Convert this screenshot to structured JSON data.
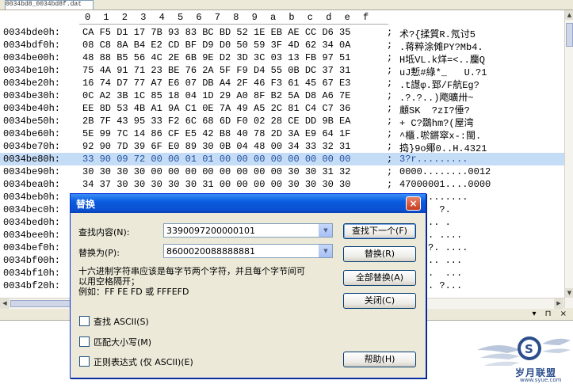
{
  "editor": {
    "tab_label": "0034bd8_0034bd8f.dat",
    "ruler": [
      "0",
      "1",
      "2",
      "3",
      "4",
      "5",
      "6",
      "7",
      "8",
      "9",
      "a",
      "b",
      "c",
      "d",
      "e",
      "f"
    ],
    "rows": [
      {
        "addr": "0034bde0h:",
        "hex": "CA F5 D1 17 7B 93 83 BC BD 52 1E EB AE CC D6 35",
        "ascii": "术?{揉質R.氖讨5"
      },
      {
        "addr": "0034bdf0h:",
        "hex": "08 C8 8A B4 E2 CD BF D9 D0 50 59 3F 4D 62 34 0A",
        "ascii": ".蒋粹涂傩PY?Mb4."
      },
      {
        "addr": "0034be00h:",
        "hex": "48 88 B5 56 4C 2E 6B 9E D2 3D 3C 03 13 FB 97 51",
        "ascii": "H坻VL.k烊=<..麕Q"
      },
      {
        "addr": "0034be10h:",
        "hex": "75 4A 91 71 23 BE 76 2A 5F F9 D4 55 0B DC 37 31",
        "ascii": "uJ慙#綠*_   U.?1"
      },
      {
        "addr": "0034be20h:",
        "hex": "16 74 D7 77 A7 E6 07 DB A4 2F 46 F3 61 45 67 E3",
        "ascii": ".t譿φ.郅/F航Eg?"
      },
      {
        "addr": "0034be30h:",
        "hex": "0C A2 3B 1C 85 18 04 1D 29 A0 8F B2 5A D8 A6 7E",
        "ascii": ".?.?..)飑曠卅~"
      },
      {
        "addr": "0034be40h:",
        "hex": "EE 8D 53 4B A1 9A C1 0E 7A 49 A5 2C 81 C4 C7 36",
        "ascii": "顪SK  ?zI?倕?"
      },
      {
        "addr": "0034be50h:",
        "hex": "2B 7F 43 95 33 F2 6C 68 6D F0 02 28 CE DD 9B EA",
        "ascii": "+ C?鵽hm?(屋湾"
      },
      {
        "addr": "0034be60h:",
        "hex": "5E 99 7C 14 86 CF E5 42 B8 40 78 2D 3A E9 64 1F",
        "ascii": "^櫃.唹鏘窣x-:閩."
      },
      {
        "addr": "0034be70h:",
        "hex": "92 90 7D 39 6F E0 89 30 0B 04 48 00 34 33 32 31",
        "ascii": "捣}9o鄊0..H.4321"
      },
      {
        "addr": "0034be80h:",
        "hex": "33 90 09 72 00 00 01 01 00 00 00 00 00 00 00 00",
        "ascii": "3?r........."
      },
      {
        "addr": "0034be90h:",
        "hex": "30 30 30 30 00 00 00 00 00 00 00 00 30 30 31 32",
        "ascii": "0000........0012"
      },
      {
        "addr": "0034bea0h:",
        "hex": "34 37 30 30 30 30 30 31 00 00 00 00 30 30 30 30",
        "ascii": "47000001....0000"
      },
      {
        "addr": "0034beb0h:",
        "hex": "",
        "ascii": "BOBB........"
      },
      {
        "addr": "0034bec0h:",
        "hex": "",
        "ascii": ".....  ?."
      },
      {
        "addr": "0034bed0h:",
        "hex": "",
        "ascii": "....... ."
      },
      {
        "addr": "0034bee0h:",
        "hex": "",
        "ascii": "... ?. ...."
      },
      {
        "addr": "0034bef0h:",
        "hex": "",
        "ascii": ".... ?. ...."
      },
      {
        "addr": "0034bf00h:",
        "hex": "",
        "ascii": "....... ..."
      },
      {
        "addr": "0034bf10h:",
        "hex": "",
        "ascii": "......  ..."
      },
      {
        "addr": "0034bf20h:",
        "hex": "",
        "ascii": "...... ?..."
      }
    ],
    "selected_row": 10,
    "lower_controls": "▾ ⊓ ×"
  },
  "dialog": {
    "title": "替换",
    "close_glyph": "×",
    "find_label": "查找内容(N):",
    "find_value": "3390097200000101",
    "replace_label": "替换为(P):",
    "replace_value": "8600020088888881",
    "hint_line1": "十六进制字符串应该是每字节两个字符，并且每个字节间可",
    "hint_line2": "以用空格隔开；",
    "hint_line3": "例如：FF FE FD 或 FFFEFD",
    "buttons": {
      "find_next": "查找下一个(F)",
      "replace": "替换(R)",
      "replace_all": "全部替换(A)",
      "close": "关闭(C)",
      "help": "帮助(H)"
    },
    "options": {
      "find_ascii": "查找 ASCII(S)",
      "match_case": "匹配大小写(M)",
      "regex": "正则表达式 (仅 ASCII)(E)"
    }
  },
  "watermark": {
    "text": "岁月联盟",
    "url": "www.syue.com"
  }
}
